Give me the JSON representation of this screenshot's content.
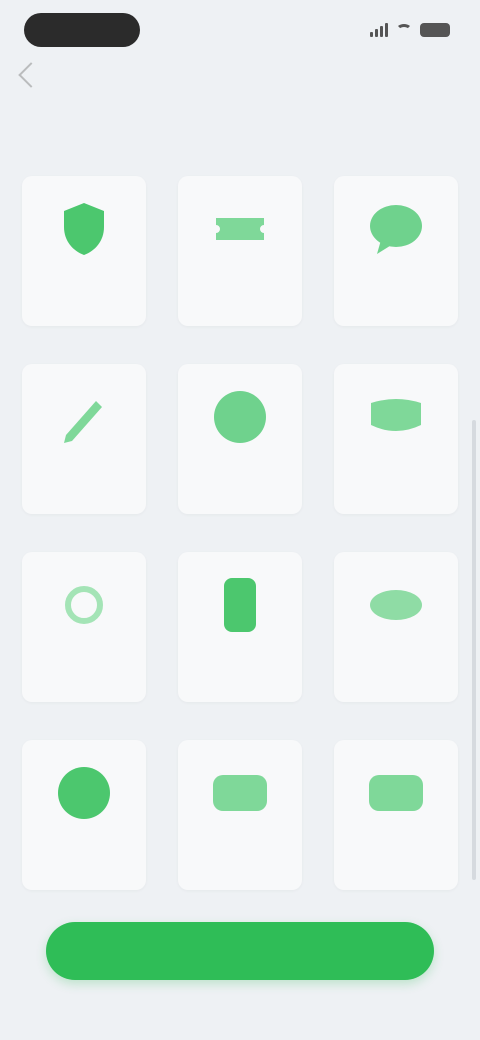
{
  "status_bar": {
    "colors": {
      "pill": "#2b2b2b",
      "icons": "#555555"
    }
  },
  "header": {
    "title": "",
    "back_icon": "chevron-left-icon"
  },
  "tabs": [
    {
      "label": ""
    },
    {
      "label": ""
    },
    {
      "label": ""
    }
  ],
  "grid": {
    "accent_color": "#4cc76e",
    "items": [
      {
        "icon": "shield-icon",
        "label": ""
      },
      {
        "icon": "ticket-icon",
        "label": ""
      },
      {
        "icon": "chat-bubble-icon",
        "label": ""
      },
      {
        "icon": "pen-icon",
        "label": ""
      },
      {
        "icon": "location-pin-icon",
        "label": ""
      },
      {
        "icon": "envelope-icon",
        "label": ""
      },
      {
        "icon": "hand-icon",
        "label": ""
      },
      {
        "icon": "phone-icon",
        "label": ""
      },
      {
        "icon": "eye-icon",
        "label": ""
      },
      {
        "icon": "globe-icon",
        "label": ""
      },
      {
        "icon": "card-icon",
        "label": ""
      },
      {
        "icon": "wallet-icon",
        "label": ""
      }
    ]
  },
  "primary_button": {
    "label": "",
    "color": "#2fbd57"
  }
}
